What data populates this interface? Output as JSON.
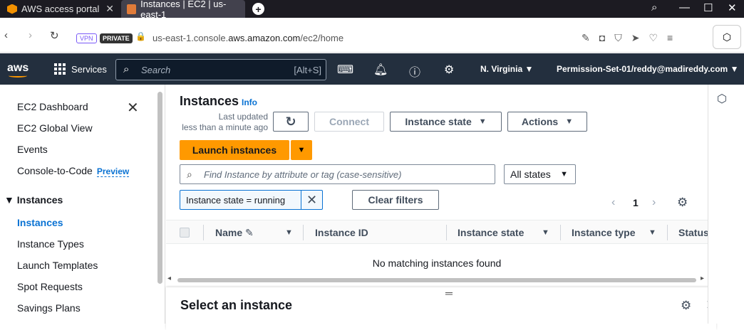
{
  "browser": {
    "tabs": [
      {
        "label": "AWS access portal"
      },
      {
        "label": "Instances | EC2 | us-east-1"
      }
    ],
    "vpn_label": "VPN",
    "private_label": "PRIVATE",
    "url_prefix": "us-east-1.console.",
    "url_domain": "aws.amazon.com",
    "url_path": "/ec2/home"
  },
  "aws_header": {
    "logo_text": "aws",
    "services_label": "Services",
    "search_placeholder": "Search",
    "search_shortcut": "[Alt+S]",
    "region": "N. Virginia",
    "account": "Permission-Set-01/reddy@madireddy.com"
  },
  "sidebar": {
    "top_items": [
      {
        "label": "EC2 Dashboard"
      },
      {
        "label": "EC2 Global View"
      },
      {
        "label": "Events"
      },
      {
        "label": "Console-to-Code",
        "badge": "Preview"
      }
    ],
    "section_label": "Instances",
    "section_items": [
      {
        "label": "Instances",
        "active": true
      },
      {
        "label": "Instance Types"
      },
      {
        "label": "Launch Templates"
      },
      {
        "label": "Spot Requests"
      },
      {
        "label": "Savings Plans"
      }
    ]
  },
  "main": {
    "title": "Instances",
    "info_label": "Info",
    "last_updated_line1": "Last updated",
    "last_updated_line2": "less than a minute ago",
    "connect_label": "Connect",
    "instance_state_label": "Instance state",
    "actions_label": "Actions",
    "launch_label": "Launch instances",
    "filter_placeholder": "Find Instance by attribute or tag (case-sensitive)",
    "state_filter_value": "All states",
    "active_filter": "Instance state = running",
    "clear_filters_label": "Clear filters",
    "page_number": "1",
    "columns": [
      {
        "label": "Name"
      },
      {
        "label": "Instance ID"
      },
      {
        "label": "Instance state"
      },
      {
        "label": "Instance type"
      },
      {
        "label": "Status"
      }
    ],
    "empty_message": "No matching instances found",
    "split_panel_title": "Select an instance"
  },
  "colors": {
    "aws_nav": "#232f3e",
    "launch_orange": "#ff9900",
    "link_blue": "#0972d3"
  }
}
